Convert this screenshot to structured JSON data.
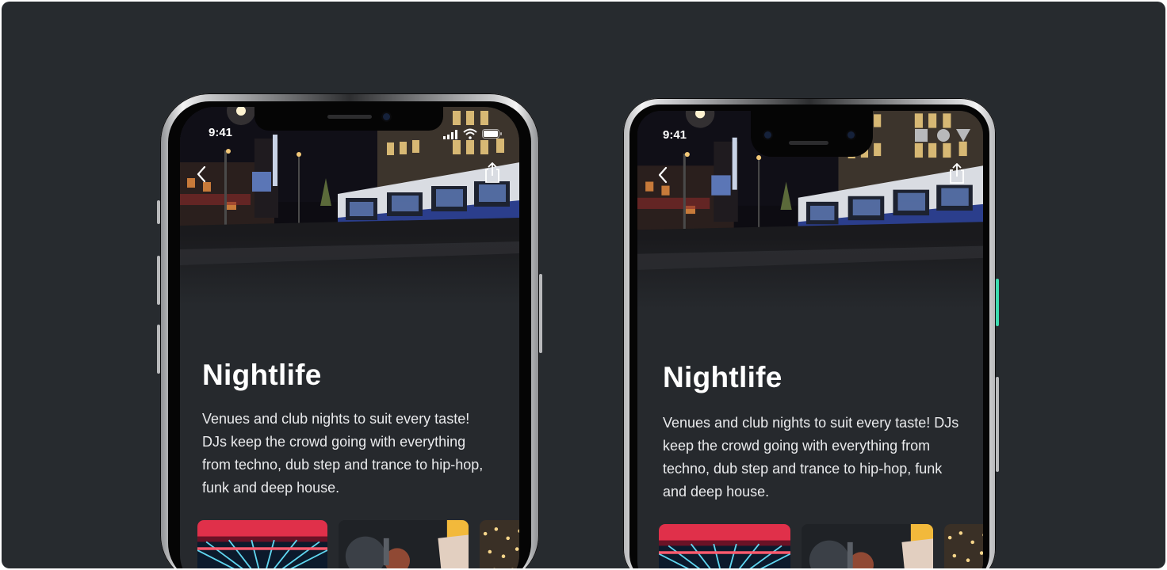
{
  "ios": {
    "status_time": "9:41",
    "title": "Nightlife",
    "description": "Venues and club nights to suit every taste! DJs keep the crowd going with everything from techno, dub step and trance to hip-hop, funk and deep house."
  },
  "android": {
    "status_time": "9:41",
    "title": "Nightlife",
    "description": "Venues and club nights to suit every taste! DJs keep the crowd going with everything from techno, dub step and trance to hip-hop, funk and deep house."
  },
  "icons": {
    "back": "chevron-left-icon",
    "share": "share-icon",
    "signal": "cellular-signal-icon",
    "wifi": "wifi-icon",
    "battery": "battery-icon",
    "android_nav": [
      "square-icon",
      "circle-icon",
      "triangle-icon"
    ]
  },
  "colors": {
    "background": "#272b2f",
    "screen": "#26292d",
    "accent_green": "#3ddbb0"
  }
}
